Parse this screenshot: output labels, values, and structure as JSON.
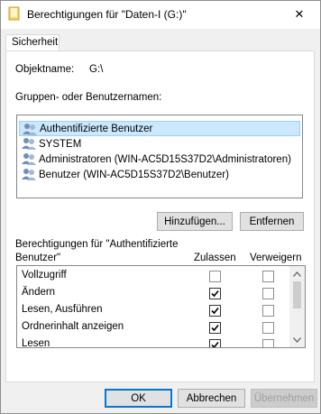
{
  "window": {
    "title": "Berechtigungen für \"Daten-I (G:)\"",
    "close_glyph": "✕"
  },
  "tabs": [
    {
      "label": "Sicherheit"
    }
  ],
  "object": {
    "label": "Objektname:",
    "value": "G:\\"
  },
  "groups": {
    "label": "Gruppen- oder Benutzernamen:",
    "items": [
      {
        "label": "Authentifizierte Benutzer",
        "selected": true
      },
      {
        "label": "SYSTEM",
        "selected": false
      },
      {
        "label": "Administratoren (WIN-AC5D15S37D2\\Administratoren)",
        "selected": false
      },
      {
        "label": "Benutzer (WIN-AC5D15S37D2\\Benutzer)",
        "selected": false
      }
    ]
  },
  "buttons": {
    "add": "Hinzufügen...",
    "remove": "Entfernen",
    "ok": "OK",
    "cancel": "Abbrechen",
    "apply": "Übernehmen"
  },
  "permissions": {
    "label_line1": "Berechtigungen für \"Authentifizierte",
    "label_line2": "Benutzer\"",
    "col_allow": "Zulassen",
    "col_deny": "Verweigern",
    "rows": [
      {
        "name": "Vollzugriff",
        "allow": false,
        "deny": false
      },
      {
        "name": "Ändern",
        "allow": true,
        "deny": false
      },
      {
        "name": "Lesen, Ausführen",
        "allow": true,
        "deny": false
      },
      {
        "name": "Ordnerinhalt anzeigen",
        "allow": true,
        "deny": false
      },
      {
        "name": "Lesen",
        "allow": true,
        "deny": false
      }
    ]
  },
  "colors": {
    "selection_bg": "#cce8ff",
    "selection_border": "#99d1ff",
    "accent": "#0078d7"
  },
  "icons": {
    "title": "folder-icon",
    "users": "users-icon",
    "close": "close-icon"
  }
}
